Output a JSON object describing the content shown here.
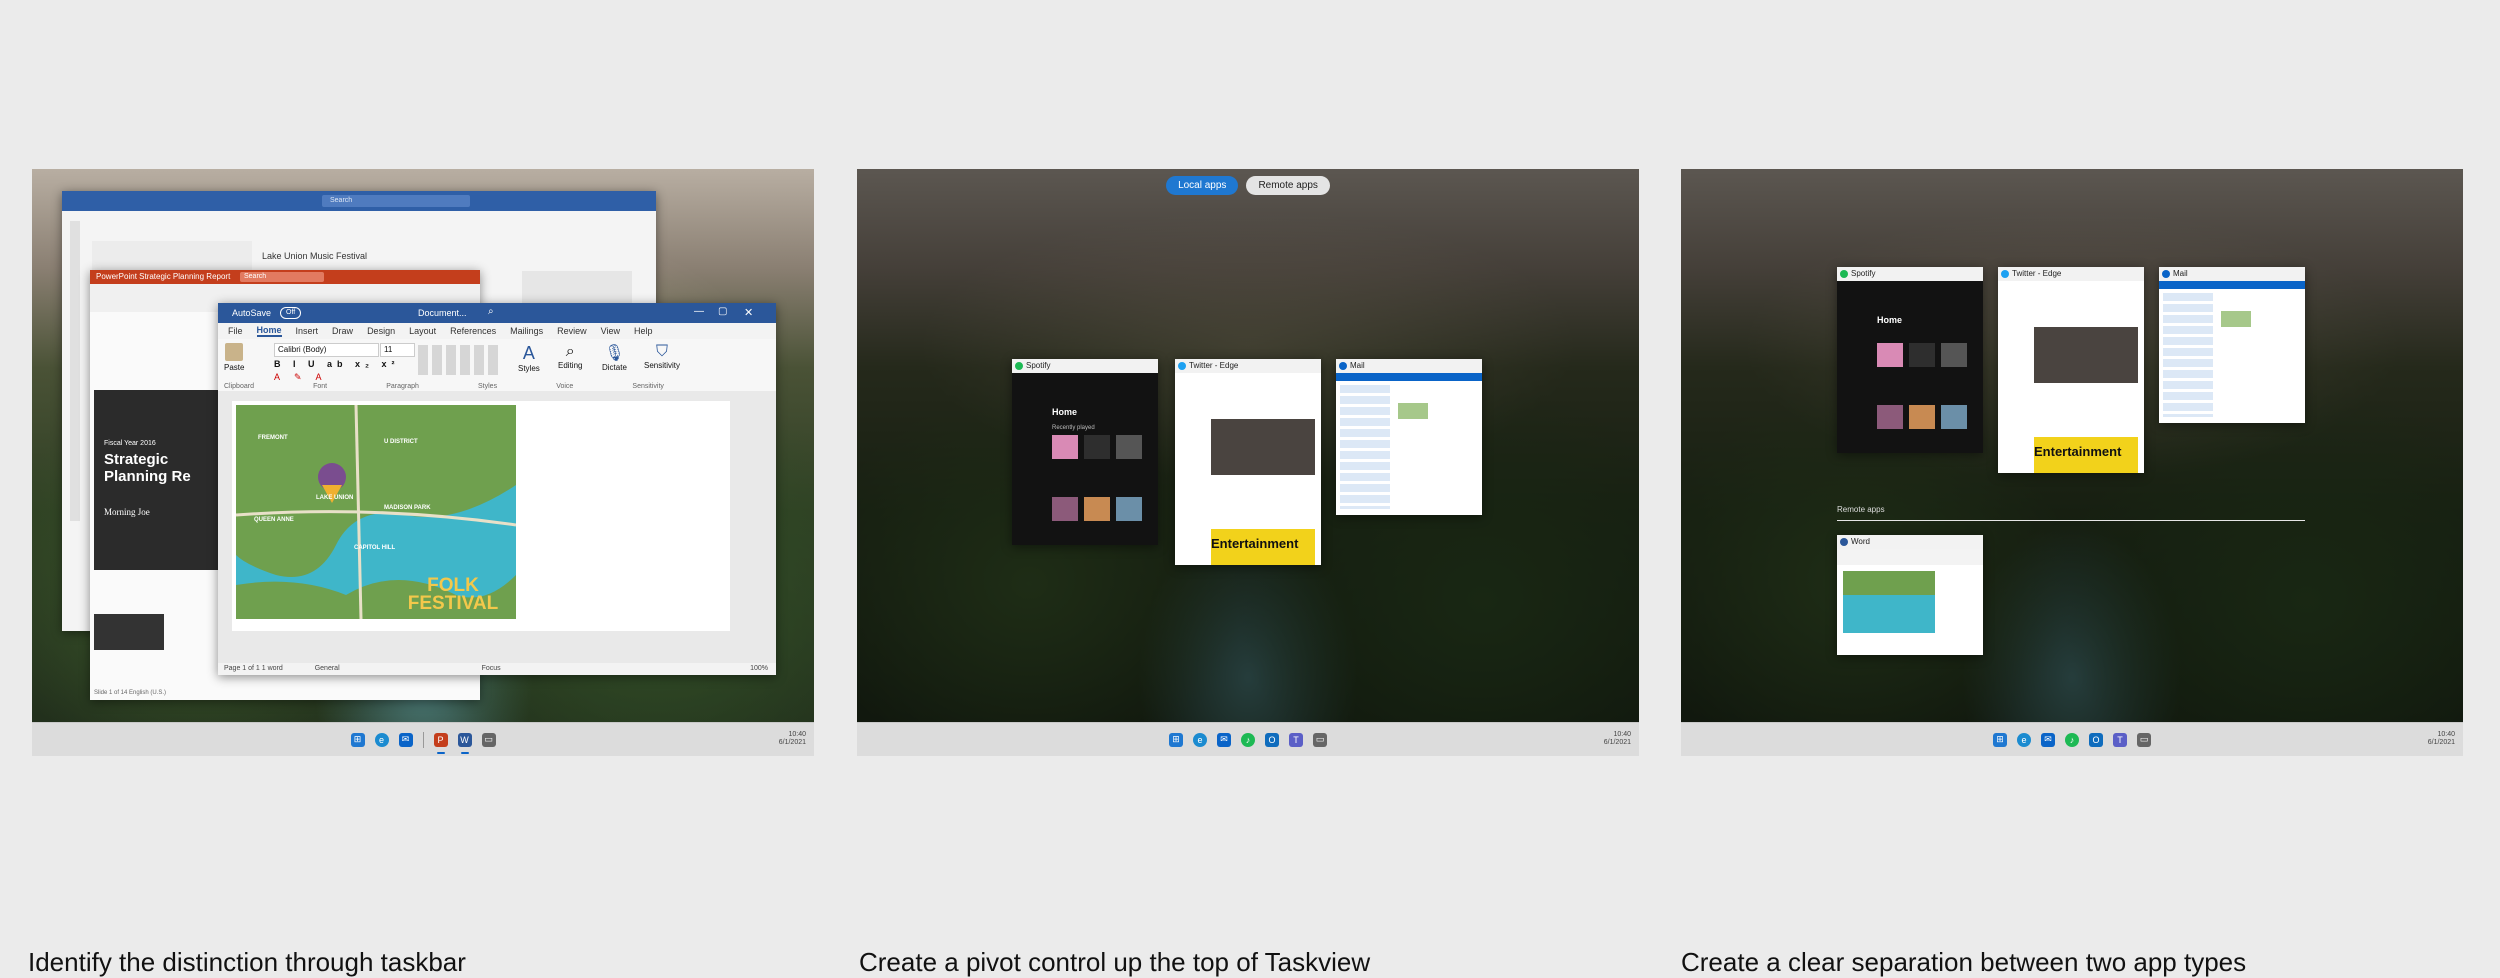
{
  "panels": [
    {
      "caption": "Identify the distinction through taskbar",
      "outlook": {
        "search_placeholder": "Search",
        "event_title": "Lake Union Music Festival"
      },
      "powerpoint": {
        "title": "PowerPoint  Strategic Planning Report",
        "search": "Search",
        "slide_kicker": "Fiscal Year 2016",
        "slide_title": "Strategic Planning Re",
        "slide_author": "Morning Joe",
        "status": "Slide 1 of 14    English (U.S.)"
      },
      "word": {
        "autosave": "AutoSave",
        "autosave_state": "Off",
        "doc_name": "Document...",
        "tabs": [
          "File",
          "Home",
          "Insert",
          "Draw",
          "Design",
          "Layout",
          "References",
          "Mailings",
          "Review",
          "View",
          "Help"
        ],
        "font_name": "Calibri (Body)",
        "font_size": "11",
        "groups": [
          "Clipboard",
          "Font",
          "Paragraph",
          "Styles",
          "Voice",
          "Sensitivity"
        ],
        "buttons": [
          "Paste",
          "Styles",
          "Editing",
          "Dictate",
          "Sensitivity"
        ],
        "map_labels": [
          "FREMONT",
          "U DISTRICT",
          "LAKE UNION",
          "QUEEN ANNE",
          "MADISON PARK",
          "CAPITOL HILL"
        ],
        "festival": "FOLK FESTIVAL",
        "status_left": "Page 1 of 1    1 word",
        "status_general": "General",
        "status_focus": "Focus",
        "zoom": "100%"
      },
      "tray_time": "10:40",
      "tray_date": "6/1/2021"
    },
    {
      "caption": "Create a pivot control up the top of Taskview",
      "pivot": {
        "local": "Local apps",
        "remote": "Remote apps"
      },
      "windows": [
        {
          "title": "Spotify",
          "color": "#1db954"
        },
        {
          "title": "Twitter - Edge",
          "color": "#1da1f2"
        },
        {
          "title": "Mail",
          "color": "#0a64c8"
        }
      ],
      "tray_time": "10:40",
      "tray_date": "6/1/2021"
    },
    {
      "caption": "Create a clear separation between two app types",
      "windows": [
        {
          "title": "Spotify",
          "color": "#1db954"
        },
        {
          "title": "Twitter - Edge",
          "color": "#1da1f2"
        },
        {
          "title": "Mail",
          "color": "#0a64c8"
        }
      ],
      "remote_label": "Remote apps",
      "remote_window": {
        "title": "Word",
        "color": "#2b579a"
      },
      "tray_time": "10:40",
      "tray_date": "6/1/2021"
    }
  ],
  "spotify_heading": "Home",
  "spotify_section": "Recently played",
  "magazine": "Entertainment"
}
